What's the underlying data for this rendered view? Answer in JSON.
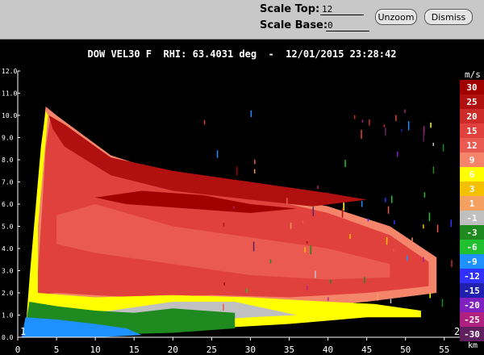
{
  "toolbar": {
    "scale_top_label": "Scale Top:",
    "scale_top_value": "12",
    "scale_base_label": "Scale Base:",
    "scale_base_value": "0",
    "unzoom_label": "Unzoom",
    "dismiss_label": "Dismiss"
  },
  "plot": {
    "title": "DOW VEL30 F  RHI: 63.4031 deg  -  12/01/2015 23:28:42",
    "corner_left": "1",
    "corner_right": "2"
  },
  "chart_data": {
    "type": "heatmap",
    "xlabel": "km",
    "ylabel": "",
    "xlim": [
      0,
      57
    ],
    "ylim": [
      0,
      12
    ],
    "x_ticks": [
      "0",
      "5",
      "10",
      "15",
      "20",
      "25",
      "30",
      "35",
      "40",
      "45",
      "50",
      "55"
    ],
    "y_ticks": [
      "0.0",
      "1.0",
      "2.0",
      "3.0",
      "4.0",
      "5.0",
      "6.0",
      "7.0",
      "8.0",
      "9.0",
      "10.0",
      "11.0",
      "12.0"
    ],
    "colorbar": {
      "unit": "m/s",
      "levels": [
        {
          "label": "30",
          "color": "#a00000"
        },
        {
          "label": "25",
          "color": "#b01010"
        },
        {
          "label": "20",
          "color": "#cf2a2a"
        },
        {
          "label": "15",
          "color": "#e0413c"
        },
        {
          "label": "12",
          "color": "#ea5a50"
        },
        {
          "label": "9",
          "color": "#f4846a"
        },
        {
          "label": "6",
          "color": "#ffff00"
        },
        {
          "label": "3",
          "color": "#f4c000"
        },
        {
          "label": "1",
          "color": "#f4a060"
        },
        {
          "label": "-1",
          "color": "#c0c0c0"
        },
        {
          "label": "-3",
          "color": "#1f8a1f"
        },
        {
          "label": "-6",
          "color": "#20c030"
        },
        {
          "label": "-9",
          "color": "#1e90ff"
        },
        {
          "label": "-12",
          "color": "#3030ff"
        },
        {
          "label": "-15",
          "color": "#2020b0"
        },
        {
          "label": "-20",
          "color": "#8020c0"
        },
        {
          "label": "-25",
          "color": "#b02080"
        },
        {
          "label": "-30",
          "color": "#602060"
        }
      ]
    },
    "regions": [
      {
        "name": "outer-echo",
        "color": "#f4846a",
        "points": [
          [
            1.0,
            0.1
          ],
          [
            1.8,
            3.0
          ],
          [
            3.0,
            8.2
          ],
          [
            3.6,
            10.4
          ],
          [
            5.0,
            10.0
          ],
          [
            12,
            8.2
          ],
          [
            20,
            7.3
          ],
          [
            30,
            6.6
          ],
          [
            40,
            5.9
          ],
          [
            48,
            5.0
          ],
          [
            54,
            3.6
          ],
          [
            54,
            2.0
          ],
          [
            45,
            1.6
          ],
          [
            35,
            1.3
          ],
          [
            25,
            1.6
          ],
          [
            15,
            1.5
          ],
          [
            5,
            1.7
          ],
          [
            1.5,
            0.1
          ]
        ]
      },
      {
        "name": "main-echo",
        "color": "#e0413c",
        "points": [
          [
            2.4,
            1.9
          ],
          [
            3.0,
            5.0
          ],
          [
            3.6,
            8.5
          ],
          [
            4.2,
            9.9
          ],
          [
            6,
            9.5
          ],
          [
            12,
            8.0
          ],
          [
            20,
            7.1
          ],
          [
            30,
            6.4
          ],
          [
            40,
            5.6
          ],
          [
            48,
            4.6
          ],
          [
            53,
            3.4
          ],
          [
            53,
            2.3
          ],
          [
            45,
            2.0
          ],
          [
            35,
            1.8
          ],
          [
            25,
            1.9
          ],
          [
            15,
            1.8
          ],
          [
            5,
            2.0
          ]
        ]
      },
      {
        "name": "inner-echo",
        "color": "#ea5a50",
        "points": [
          [
            5,
            5.5
          ],
          [
            10,
            6.0
          ],
          [
            20,
            5.0
          ],
          [
            30,
            4.5
          ],
          [
            40,
            4.0
          ],
          [
            48,
            3.3
          ],
          [
            48,
            2.7
          ],
          [
            40,
            2.6
          ],
          [
            30,
            2.8
          ],
          [
            20,
            3.3
          ],
          [
            10,
            3.8
          ],
          [
            5,
            4.2
          ]
        ]
      },
      {
        "name": "upper-core",
        "color": "#b01010",
        "points": [
          [
            4.0,
            10.0
          ],
          [
            6,
            9.6
          ],
          [
            12,
            8.1
          ],
          [
            20,
            7.5
          ],
          [
            30,
            7.0
          ],
          [
            40,
            6.5
          ],
          [
            45,
            6.2
          ],
          [
            38,
            5.9
          ],
          [
            30,
            6.2
          ],
          [
            20,
            6.6
          ],
          [
            12,
            7.3
          ],
          [
            6,
            8.6
          ],
          [
            4.5,
            9.4
          ]
        ]
      },
      {
        "name": "inner-core",
        "color": "#a00000",
        "points": [
          [
            10,
            6.3
          ],
          [
            16,
            6.6
          ],
          [
            24,
            6.4
          ],
          [
            30,
            6.0
          ],
          [
            36,
            5.8
          ],
          [
            30,
            5.6
          ],
          [
            22,
            5.8
          ],
          [
            14,
            6.0
          ]
        ]
      },
      {
        "name": "yellow-band",
        "color": "#ffff00",
        "points": [
          [
            1.0,
            0.3
          ],
          [
            1.6,
            3.0
          ],
          [
            3.0,
            8.6
          ],
          [
            3.6,
            10.2
          ],
          [
            3.9,
            10.0
          ],
          [
            2.6,
            5.0
          ],
          [
            2.6,
            2.0
          ],
          [
            10,
            1.8
          ],
          [
            20,
            1.9
          ],
          [
            30,
            1.8
          ],
          [
            40,
            1.6
          ],
          [
            46,
            1.5
          ],
          [
            52,
            1.2
          ],
          [
            52,
            0.9
          ],
          [
            45,
            0.9
          ],
          [
            35,
            0.6
          ],
          [
            25,
            0.4
          ],
          [
            15,
            0.6
          ],
          [
            5,
            0.3
          ]
        ]
      },
      {
        "name": "gray-band",
        "color": "#c0c0c0",
        "points": [
          [
            2.0,
            0.4
          ],
          [
            10,
            1.1
          ],
          [
            20,
            1.6
          ],
          [
            28,
            1.6
          ],
          [
            36,
            1.0
          ],
          [
            30,
            0.9
          ],
          [
            22,
            0.7
          ],
          [
            12,
            0.4
          ],
          [
            4,
            0.3
          ]
        ]
      },
      {
        "name": "green-band",
        "color": "#1f8a1f",
        "points": [
          [
            0.8,
            0.1
          ],
          [
            1.5,
            1.6
          ],
          [
            5,
            1.4
          ],
          [
            10,
            1.2
          ],
          [
            15,
            1.1
          ],
          [
            20,
            1.3
          ],
          [
            28,
            1.1
          ],
          [
            28,
            0.4
          ],
          [
            20,
            0.2
          ],
          [
            10,
            0.1
          ]
        ]
      },
      {
        "name": "blue-ground",
        "color": "#1e90ff",
        "points": [
          [
            0.5,
            0.0
          ],
          [
            1.0,
            0.9
          ],
          [
            5,
            0.8
          ],
          [
            10,
            0.6
          ],
          [
            14,
            0.4
          ],
          [
            16,
            0.1
          ],
          [
            10,
            0.0
          ]
        ]
      }
    ]
  }
}
